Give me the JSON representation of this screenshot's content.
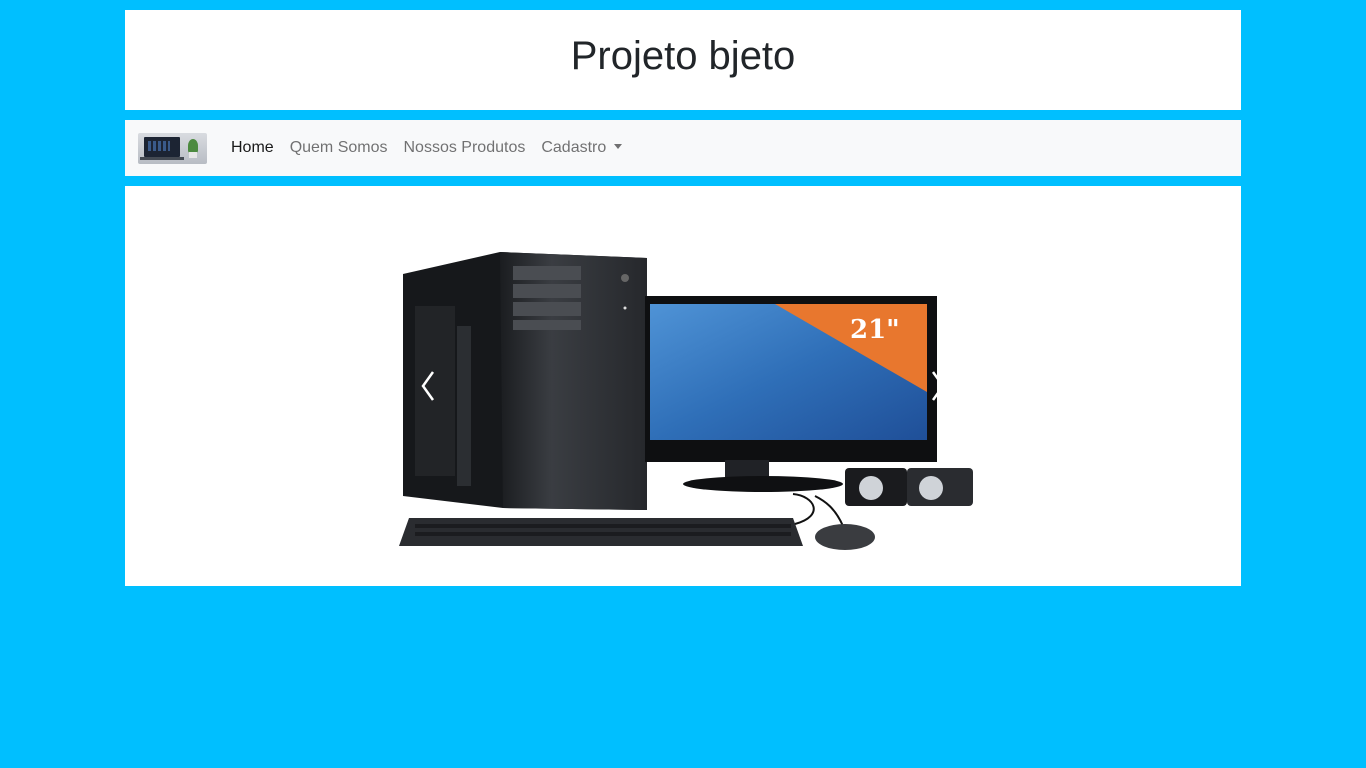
{
  "header": {
    "title": "Projeto bjeto"
  },
  "navbar": {
    "brand_icon": "laptop-logo-icon",
    "items": [
      {
        "label": "Home",
        "active": true
      },
      {
        "label": "Quem Somos",
        "active": false
      },
      {
        "label": "Nossos Produtos",
        "active": false
      },
      {
        "label": "Cadastro",
        "active": false,
        "dropdown": true
      }
    ]
  },
  "carousel": {
    "slide_image": "desktop-computer-illustration",
    "monitor_badge": "21\"",
    "prev_icon": "chevron-left-icon",
    "next_icon": "chevron-right-icon"
  },
  "colors": {
    "page_background": "#00bfff",
    "panel_background": "#ffffff",
    "navbar_background": "#f8f9fa",
    "badge_orange": "#e8772e"
  }
}
